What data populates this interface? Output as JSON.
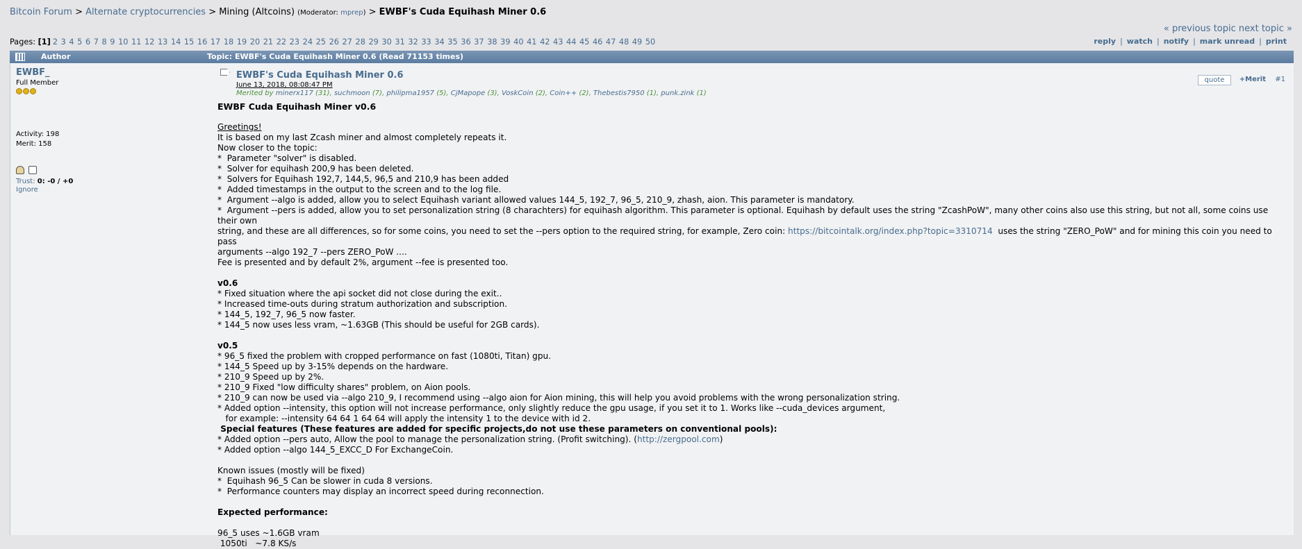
{
  "breadcrumb": {
    "forum": "Bitcoin Forum",
    "sep": " > ",
    "board1": "Alternate cryptocurrencies",
    "board2": "Mining (Altcoins)",
    "moderator_prefix": "(Moderator: ",
    "moderator": "mprep",
    "moderator_suffix": ")",
    "topic": "EWBF's Cuda Equihash Miner 0.6"
  },
  "topic_nav": {
    "prev": "« previous topic",
    "next": "next topic »"
  },
  "pages": {
    "label": "Pages:",
    "current": "[1]",
    "list": [
      "2",
      "3",
      "4",
      "5",
      "6",
      "7",
      "8",
      "9",
      "10",
      "11",
      "12",
      "13",
      "14",
      "15",
      "16",
      "17",
      "18",
      "19",
      "20",
      "21",
      "22",
      "23",
      "24",
      "25",
      "26",
      "27",
      "28",
      "29",
      "30",
      "31",
      "32",
      "33",
      "34",
      "35",
      "36",
      "37",
      "38",
      "39",
      "40",
      "41",
      "42",
      "43",
      "44",
      "45",
      "46",
      "47",
      "48",
      "49",
      "50"
    ]
  },
  "actions": [
    "reply",
    "watch",
    "notify",
    "mark unread",
    "print"
  ],
  "catbar": {
    "author": "Author",
    "topic": "Topic: EWBF's Cuda Equihash Miner 0.6  (Read 71153 times)"
  },
  "poster": {
    "name": "EWBF_",
    "rank": "Full Member",
    "stars": 3,
    "activity": "Activity: 198",
    "merit": "Merit: 158",
    "trust_label": "Trust:",
    "trust_value": "0: -0 / +0",
    "ignore": "Ignore"
  },
  "post": {
    "subject": "EWBF's Cuda Equihash Miner 0.6",
    "date": "June 13, 2018, 08:08:47 PM",
    "merited_prefix": "Merited by",
    "merited_by": [
      {
        "name": "minerx117",
        "count": "(31)"
      },
      {
        "name": "suchmoon",
        "count": "(7)"
      },
      {
        "name": "philipma1957",
        "count": "(5)"
      },
      {
        "name": "CjMapope",
        "count": "(3)"
      },
      {
        "name": "VoskCoin",
        "count": "(2)"
      },
      {
        "name": "Coin++",
        "count": "(2)"
      },
      {
        "name": "Thebestis7950",
        "count": "(1)"
      },
      {
        "name": "punk.zink",
        "count": "(1)"
      }
    ],
    "quote_label": "quote",
    "merit_label": "+Merit",
    "number": "#1",
    "headline": "EWBF Cuda Equihash Miner v0.6",
    "greetings": "Greetings!",
    "intro": [
      "It is based on my last Zcash miner and almost completely repeats it.",
      "Now closer to the topic:",
      "*  Parameter \"solver\" is disabled.",
      "*  Solver for equihash 200,9 has been deleted.",
      "*  Solvers for Equihash 192,7, 144,5, 96,5 and 210,9 has been added",
      "*  Added timestamps in the output to the screen and to the log file.",
      "*  Argument --algo is added, allow you to select Equihash variant allowed values 144_5, 192_7, 96_5, 210_9, zhash, aion. This parameter is mandatory."
    ],
    "pers_line_1": "*  Argument --pers is added, allow you to set personalization string (8 charachters) for equihash algorithm. This parameter is optional. Equihash by default uses the string \"ZcashPoW\", many other coins also use this string, but not all, some coins use their own",
    "pers_line_2a": "string, and these are all differences, so for some coins, you need to set the --pers option to the required string, for example, Zero coin: ",
    "pers_link": "https://bitcointalk.org/index.php?topic=3310714",
    "pers_line_2b": "  uses the string \"ZERO_PoW\" and for mining this coin you need to pass",
    "pers_line_3": "arguments --algo 192_7 --pers ZERO_PoW ....",
    "fee_line": "Fee is presented and by default 2%, argument --fee is presented too.",
    "v06_title": "v0.6",
    "v06_items": [
      "* Fixed situation where the api socket did not close during the exit..",
      "* Increased time-outs during stratum authorization and subscription.",
      "* 144_5, 192_7, 96_5 now faster.",
      "* 144_5 now uses less vram, ~1.63GB (This should be useful for 2GB cards)."
    ],
    "v05_title": "v0.5",
    "v05_items": [
      "* 96_5 fixed the problem with cropped performance on fast (1080ti, Titan) gpu.",
      "* 144_5 Speed up by 3-15% depends on the hardware.",
      "* 210_9 Speed up by 2%.",
      "* 210_9 Fixed \"low difficulty shares\" problem, on Aion pools.",
      "* 210_9 can now be used via --algo 210_9, I recommend using --algo aion for Aion mining, this will help you avoid problems with the wrong personalization string.",
      "* Added option --intensity, this option will not increase performance, only slightly reduce the gpu usage, if you set it to 1. Works like --cuda_devices argument,",
      "   for example: --intensity 64 64 1 64 64 will apply the intensity 1 to the device with id 2."
    ],
    "special_title": " Special features (These features are added for specific projects,do not use these parameters on conventional pools):",
    "special_1a": "* Added option --pers auto, Allow the pool to manage the personalization string. (Profit switching). (",
    "special_link": "http://zergpool.com",
    "special_1b": ")",
    "special_2": "* Added option --algo 144_5_EXCC_D For ExchangeCoin.",
    "known_title": "Known issues (mostly will be fixed)",
    "known_items": [
      "*  Equihash 96_5 Can be slower in cuda 8 versions.",
      "*  Performance counters may display an incorrect speed during reconnection."
    ],
    "expected_title": "Expected performance:",
    "perf_items": [
      "96_5 uses ~1.6GB vram",
      " 1050ti   ~7.8 KS/s"
    ]
  }
}
